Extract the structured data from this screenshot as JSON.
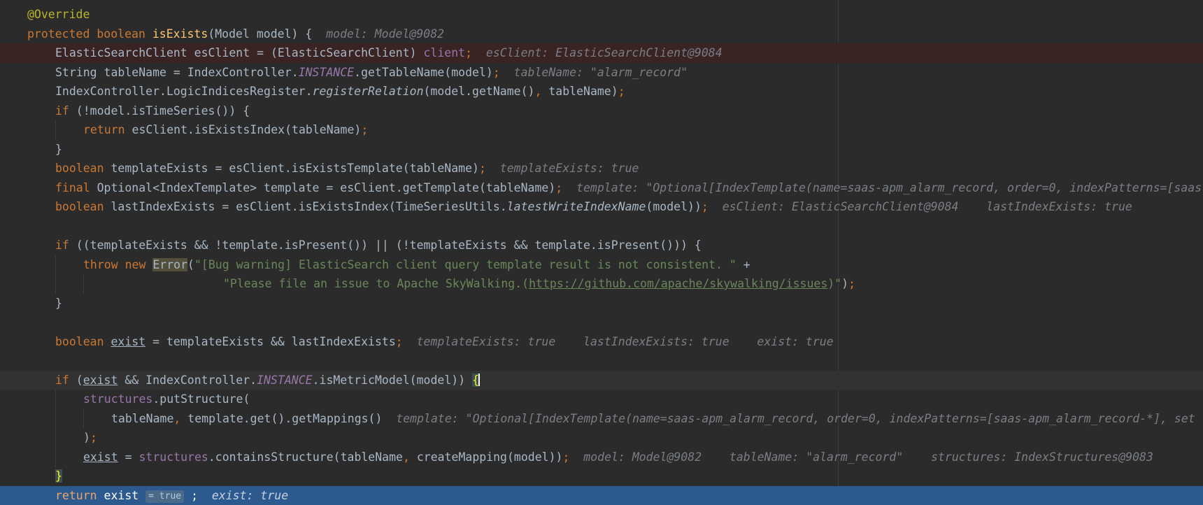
{
  "editor": {
    "lines": {
      "l1": {
        "annotation": "@Override"
      },
      "l2": {
        "kw1": "protected",
        "kw2": "boolean",
        "method": "isExists",
        "params": "(Model model) {",
        "hint": "model: Model@9082"
      },
      "l3": {
        "text": "ElasticSearchClient esClient = (ElasticSearchClient) ",
        "field": "client",
        "semi": ";",
        "hint": "esClient: ElasticSearchClient@9084"
      },
      "l4": {
        "pre": "String tableName = IndexController.",
        "sfield": "INSTANCE",
        "post": ".getTableName(model)",
        "semi": ";",
        "hint": "tableName: \"alarm_record\""
      },
      "l5": {
        "pre": "IndexController.LogicIndicesRegister.",
        "ital": "registerRelation",
        "post": "(model.getName()",
        "comma": ",",
        "post2": " tableName)",
        "semi": ";"
      },
      "l6": {
        "kw": "if",
        "text": " (!model.isTimeSeries()) {"
      },
      "l7": {
        "kw": "return",
        "text": " esClient.isExistsIndex(tableName)",
        "semi": ";"
      },
      "l8": {
        "text": "}"
      },
      "l9": {
        "kw": "boolean",
        "text": " templateExists = esClient.isExistsTemplate(tableName)",
        "semi": ";",
        "hint": "templateExists: true"
      },
      "l10": {
        "kw": "final",
        "text": " Optional<IndexTemplate> template = esClient.getTemplate(tableName)",
        "semi": ";",
        "hint": "template: \"Optional[IndexTemplate(name=saas-apm_alarm_record, order=0, indexPatterns=[saas"
      },
      "l11": {
        "kw": "boolean",
        "text": " lastIndexExists = esClient.isExistsIndex(TimeSeriesUtils.",
        "ital": "latestWriteIndexName",
        "post": "(model))",
        "semi": ";",
        "hint1": "esClient: ElasticSearchClient@9084",
        "hint2": "lastIndexExists: true"
      },
      "l13": {
        "kw": "if",
        "text": " ((templateExists && !template.isPresent()) || (!templateExists && template.isPresent())) {"
      },
      "l14": {
        "kw1": "throw",
        "kw2": "new",
        "err": "Error",
        "paren": "(",
        "str": "\"[Bug warning] ElasticSearch client query template result is not consistent. \"",
        "plus": " +"
      },
      "l15": {
        "str1": "\"Please file an issue to Apache SkyWalking.(",
        "link": "https://github.com/apache/skywalking/issues",
        "str2": ")\"",
        "tail": ")",
        "semi": ";"
      },
      "l16": {
        "text": "}"
      },
      "l18": {
        "kw": "boolean",
        "var": "exist",
        "text": " = templateExists && lastIndexExists",
        "semi": ";",
        "hint1": "templateExists: true",
        "hint2": "lastIndexExists: true",
        "hint3": "exist: true"
      },
      "l20": {
        "kw": "if",
        "pre": " (",
        "var": "exist",
        "mid": " && IndexController.",
        "sfield": "INSTANCE",
        "post": ".isMetricModel(model)) ",
        "brace": "{"
      },
      "l21": {
        "field": "structures",
        "text": ".putStructure("
      },
      "l22": {
        "text": "tableName",
        "comma": ",",
        "text2": " template.get().getMappings()",
        "hint": "template: \"Optional[IndexTemplate(name=saas-apm_alarm_record, order=0, indexPatterns=[saas-apm_alarm_record-*], set"
      },
      "l23": {
        "text": ")",
        "semi": ";"
      },
      "l24": {
        "var": "exist",
        "eq": " = ",
        "field": "structures",
        "text": ".containsStructure(tableName",
        "comma": ",",
        "text2": " createMapping(model))",
        "semi": ";",
        "hint1": "model: Model@9082",
        "hint2": "tableName: \"alarm_record\"",
        "hint3": "structures: IndexStructures@9083"
      },
      "l25": {
        "brace": "}"
      },
      "l26": {
        "kw": "return",
        "var": "exist",
        "inline": "= true",
        "semi": ";",
        "hint": "exist: true"
      }
    }
  }
}
